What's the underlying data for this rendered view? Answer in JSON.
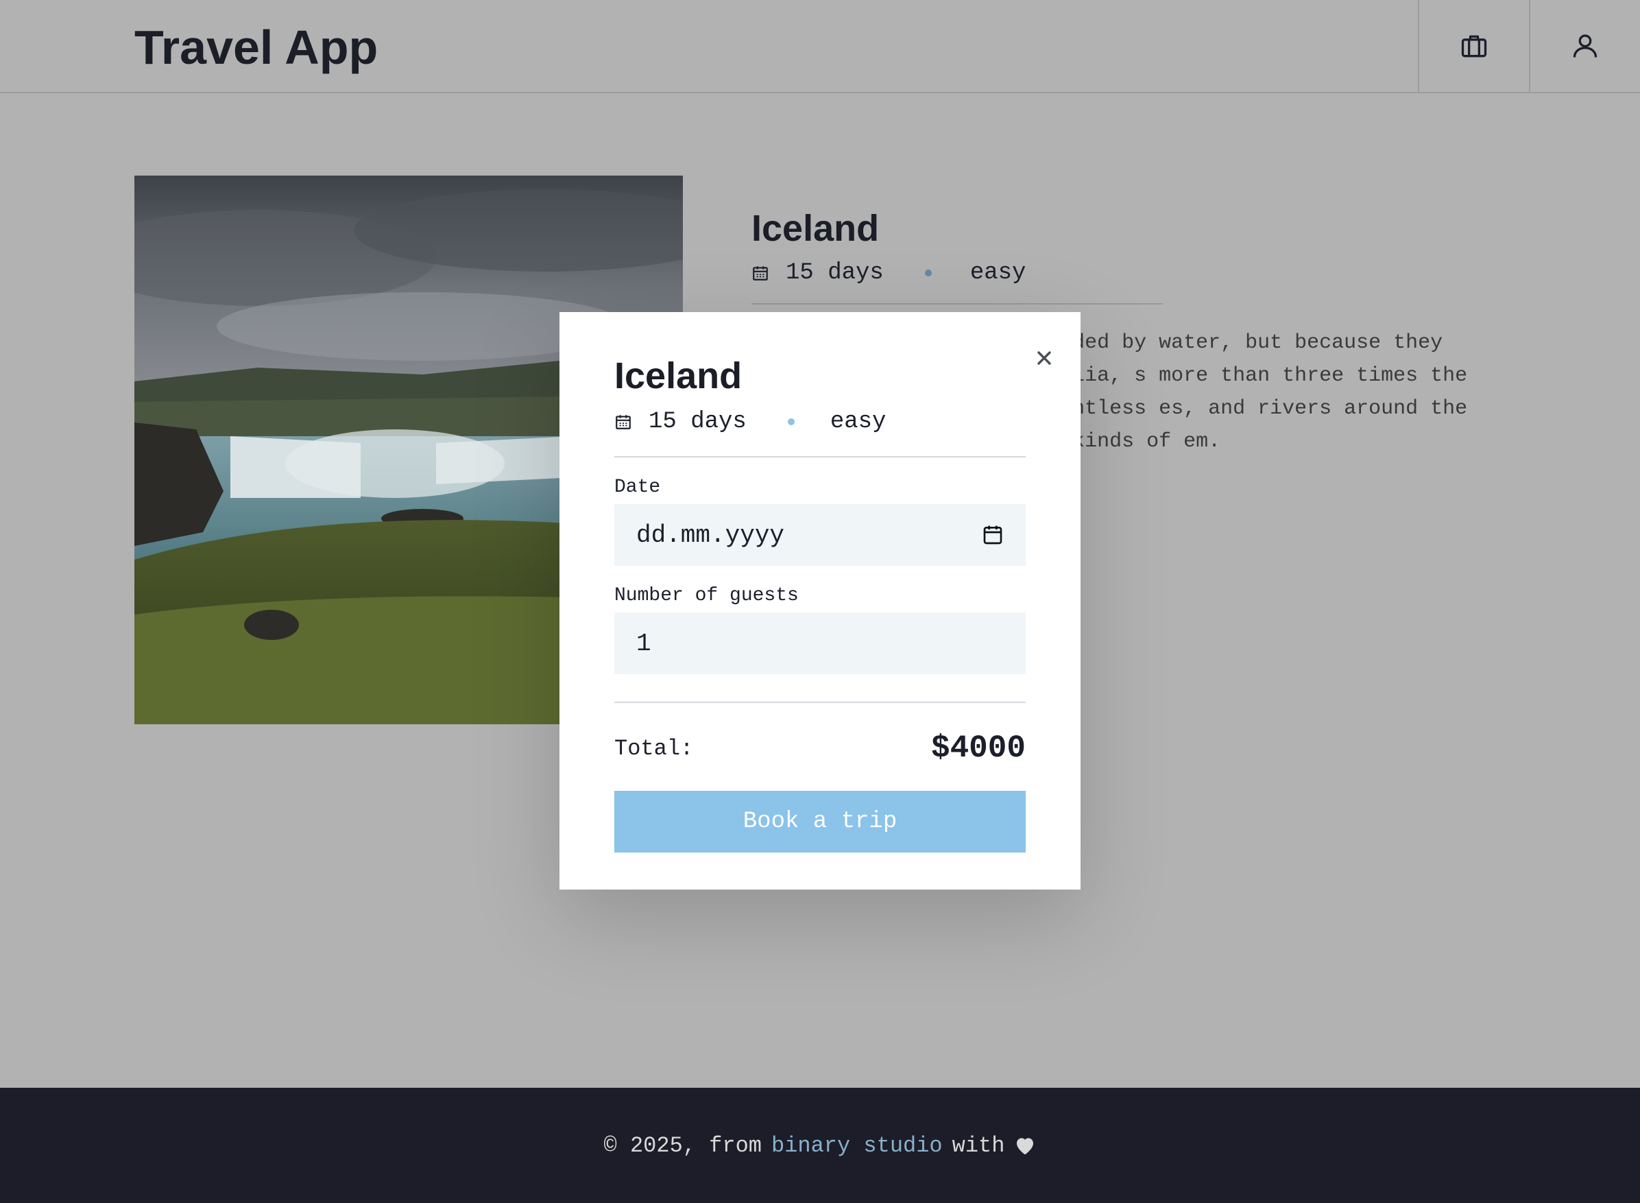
{
  "header": {
    "logo": "Travel App",
    "nav": [
      {
        "name": "bookings",
        "icon": "briefcase-icon"
      },
      {
        "name": "profile",
        "icon": "user-icon"
      }
    ]
  },
  "trip": {
    "title": "Iceland",
    "duration": "15 days",
    "level": "easy",
    "description_visible": "nd surrounded by water. unded by water, but because they considered islands. Australia, s more than three times the size island. There are countless es, and rivers around the world. , climate, and the kinds of em.",
    "image_alt": "waterfall in Iceland"
  },
  "modal": {
    "title": "Iceland",
    "duration": "15 days",
    "level": "easy",
    "date_label": "Date",
    "date_placeholder": "dd.mm.yyyy",
    "guests_label": "Number of guests",
    "guests_value": "1",
    "total_label": "Total:",
    "total_value": "$4000",
    "book_button": "Book a trip",
    "close_icon": "close-icon"
  },
  "footer": {
    "prefix": "© 2025, from",
    "brand": "binary studio",
    "suffix": "with",
    "heart_icon": "heart-icon"
  },
  "colors": {
    "accent": "#8bc3e9",
    "dot": "#5f8aa8",
    "footer_bg": "#1c1d28",
    "overlay_bg": "#b2b2b2"
  }
}
